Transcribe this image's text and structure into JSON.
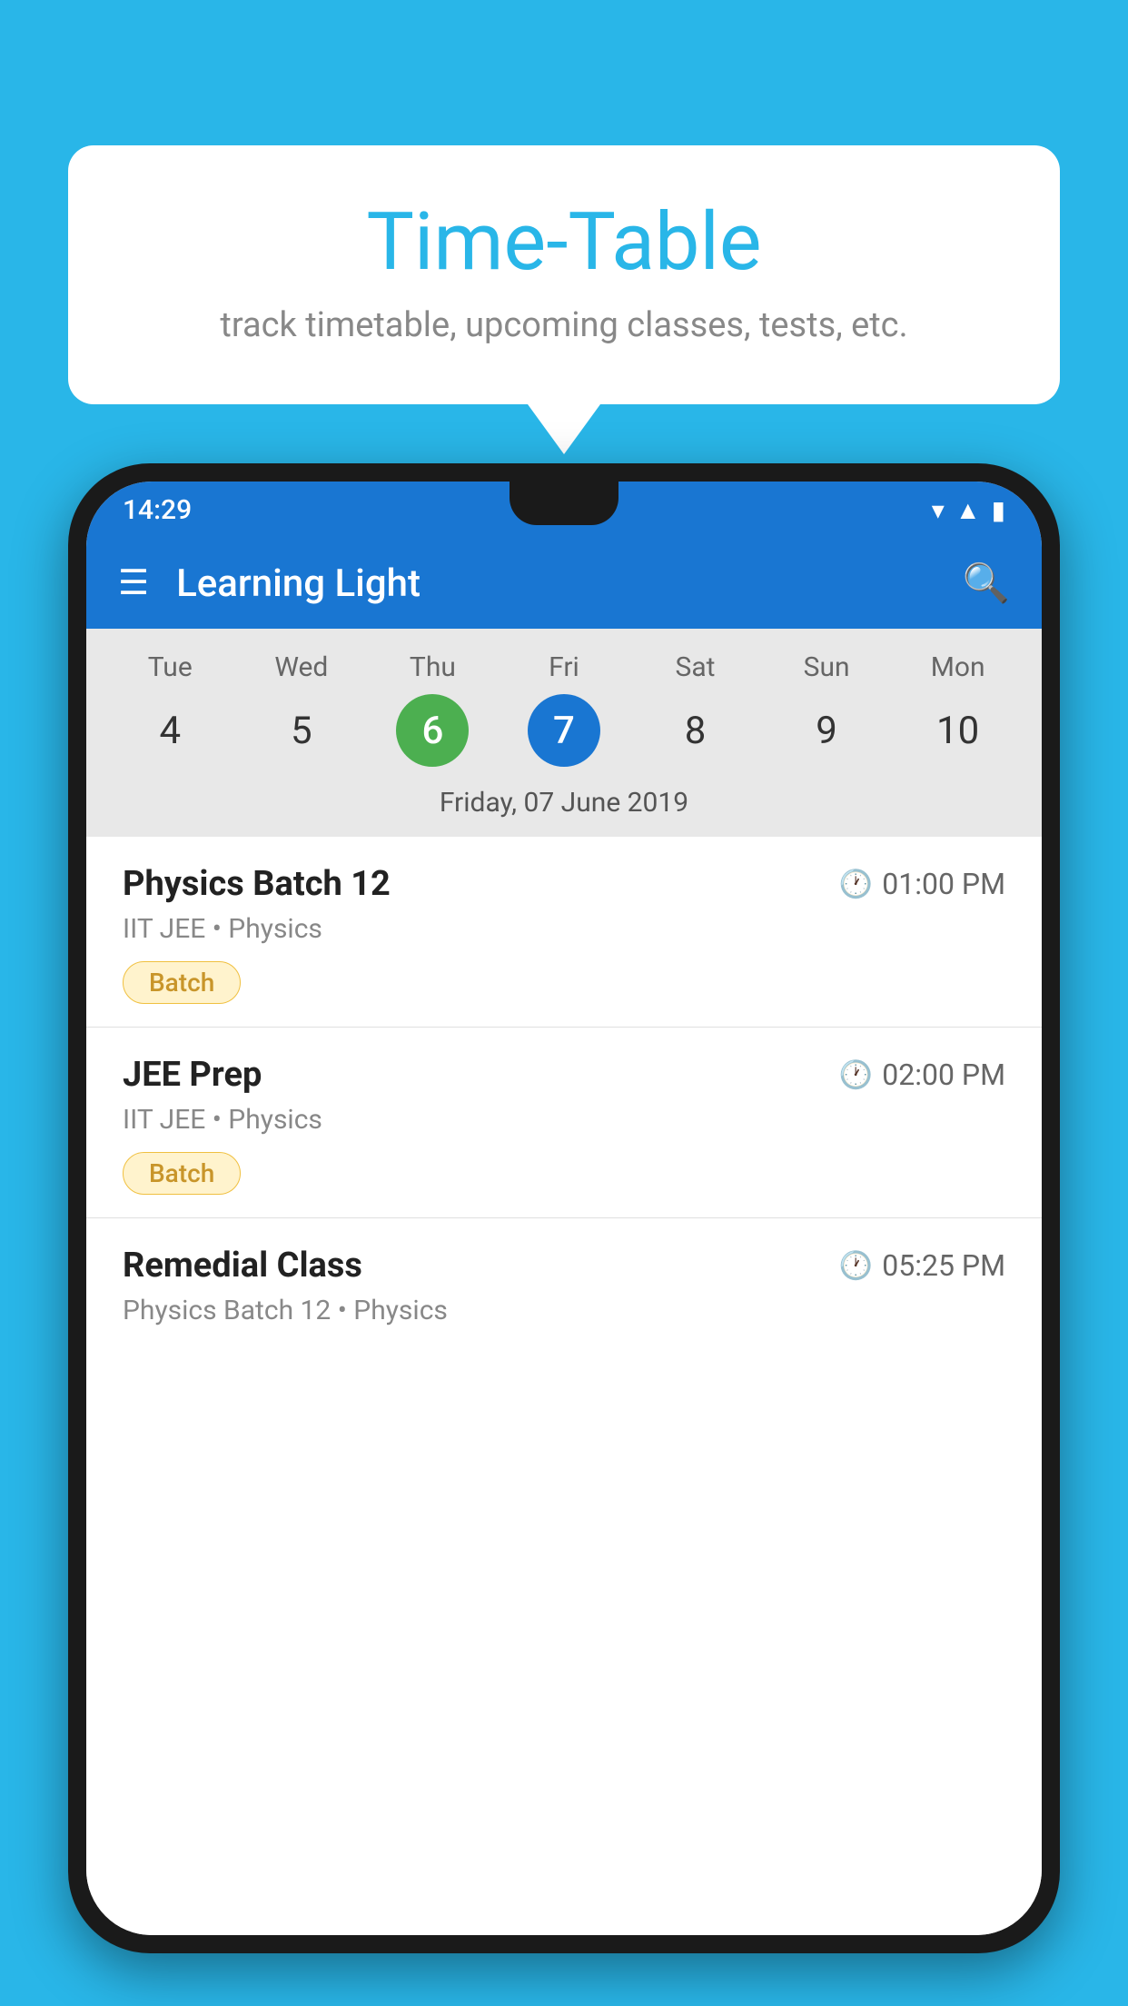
{
  "background": {
    "color": "#29b6e8"
  },
  "speech_bubble": {
    "title": "Time-Table",
    "subtitle": "track timetable, upcoming classes, tests, etc."
  },
  "phone": {
    "status_bar": {
      "time": "14:29"
    },
    "app_bar": {
      "title": "Learning Light"
    },
    "calendar": {
      "days": [
        {
          "name": "Tue",
          "number": "4",
          "state": "normal"
        },
        {
          "name": "Wed",
          "number": "5",
          "state": "normal"
        },
        {
          "name": "Thu",
          "number": "6",
          "state": "today"
        },
        {
          "name": "Fri",
          "number": "7",
          "state": "selected"
        },
        {
          "name": "Sat",
          "number": "8",
          "state": "normal"
        },
        {
          "name": "Sun",
          "number": "9",
          "state": "normal"
        },
        {
          "name": "Mon",
          "number": "10",
          "state": "normal"
        }
      ],
      "selected_date_label": "Friday, 07 June 2019"
    },
    "schedule": [
      {
        "title": "Physics Batch 12",
        "time": "01:00 PM",
        "subtitle": "IIT JEE • Physics",
        "badge": "Batch"
      },
      {
        "title": "JEE Prep",
        "time": "02:00 PM",
        "subtitle": "IIT JEE • Physics",
        "badge": "Batch"
      },
      {
        "title": "Remedial Class",
        "time": "05:25 PM",
        "subtitle": "Physics Batch 12 • Physics",
        "badge": null,
        "partial": true
      }
    ]
  }
}
